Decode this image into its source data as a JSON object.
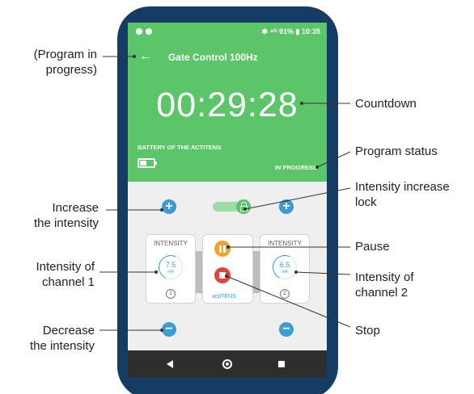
{
  "status_bar": {
    "right_text": "✱ ⁴ᴳ 91% ▮ 10:35"
  },
  "header": {
    "back_icon": "arrow-left-icon",
    "title": "Gate Control 100Hz"
  },
  "timer": {
    "countdown": "00:29:28"
  },
  "battery": {
    "label": "BATTERY OF THE ACTITENS",
    "level_fraction": 0.35
  },
  "program_status": "IN PROGRESS",
  "controls": {
    "increase_icon": "+",
    "decrease_icon": "−",
    "lock_state": "unlocked"
  },
  "channel_1": {
    "title": "INTENSITY",
    "value": "7.5",
    "unit": "mA",
    "number": "1"
  },
  "channel_2": {
    "title": "INTENSITY",
    "value": "6.5",
    "unit": "mA",
    "number": "2"
  },
  "center_panel": {
    "brand": "actiTENS"
  },
  "annotations": {
    "program_in_progress_line1": "(Program in",
    "program_in_progress_line2": "progress)",
    "countdown": "Countdown",
    "program_status": "Program status",
    "intensity_lock_line1": "Intensity increase",
    "intensity_lock_line2": "lock",
    "increase_line1": "Increase",
    "increase_line2": "the intensity",
    "pause": "Pause",
    "channel1_line1": "Intensity of",
    "channel1_line2": "channel 1",
    "channel2_line1": "Intensity of",
    "channel2_line2": "channel 2",
    "decrease_line1": "Decrease",
    "decrease_line2": "the intensity",
    "stop": "Stop"
  },
  "colors": {
    "phone_frame": "#153d63",
    "header_green": "#5cc469",
    "accent_blue": "#3a9bd5",
    "pause_orange": "#f4a22d",
    "stop_red": "#e4453a"
  }
}
